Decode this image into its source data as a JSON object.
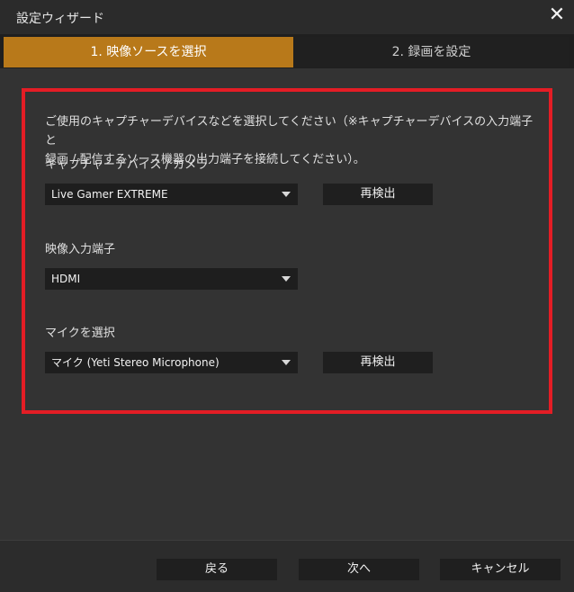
{
  "window": {
    "title": "設定ウィザード",
    "close_glyph": "✕"
  },
  "tabs": [
    {
      "label": "1. 映像ソースを選択",
      "active": true
    },
    {
      "label": "2. 録画を設定",
      "active": false
    }
  ],
  "main": {
    "description_line1": "ご使用のキャプチャーデバイスなどを選択してください（※キャプチャーデバイスの入力端子と",
    "description_line2": "録画 / 配信するソース機器の出力端子を接続してください）。",
    "capture_device": {
      "label": "キャプチャーデバイス / カメラ",
      "selected": "Live Gamer EXTREME",
      "rescan_label": "再検出"
    },
    "video_input": {
      "label": "映像入力端子",
      "selected": "HDMI"
    },
    "mic": {
      "label": "マイクを選択",
      "selected": "マイク (Yeti Stereo Microphone)",
      "rescan_label": "再検出"
    }
  },
  "footer": {
    "back_label": "戻る",
    "next_label": "次へ",
    "cancel_label": "キャンセル"
  },
  "colors": {
    "active_tab": "#b8791a",
    "highlight_border": "#e41d25",
    "background": "#333333",
    "control_bg": "#1e1e1e"
  }
}
